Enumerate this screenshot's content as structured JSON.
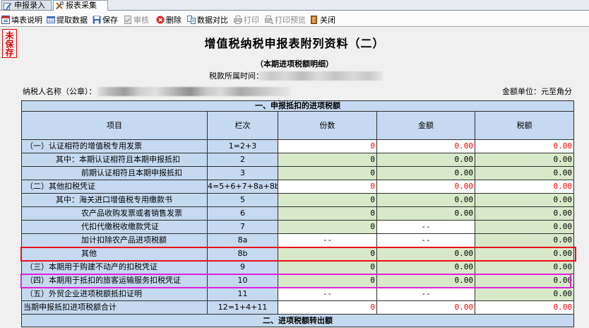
{
  "tabs": [
    {
      "label": "申报录入",
      "icon": "pencil-icon",
      "active": false
    },
    {
      "label": "报表采集",
      "icon": "tools-icon",
      "active": true
    }
  ],
  "toolbar": [
    {
      "label": "填表说明",
      "icon": "form-guide-icon",
      "enabled": true
    },
    {
      "label": "提取数据",
      "icon": "extract-data-icon",
      "enabled": true
    },
    {
      "label": "保存",
      "icon": "save-icon",
      "enabled": true
    },
    {
      "label": "审核",
      "icon": "audit-icon",
      "enabled": false
    },
    {
      "label": "删除",
      "icon": "delete-icon",
      "enabled": true
    },
    {
      "label": "数据对比",
      "icon": "compare-icon",
      "enabled": true
    },
    {
      "label": "打印",
      "icon": "print-icon",
      "enabled": false
    },
    {
      "label": "打印预览",
      "icon": "print-preview-icon",
      "enabled": false
    },
    {
      "label": "关闭",
      "icon": "close-icon",
      "enabled": true
    }
  ],
  "stamp": "未保存",
  "form": {
    "title": "增值税纳税申报表附列资料（二）",
    "subtitle": "（本期进项税额明细）",
    "period_label": "税款所属时间：",
    "taxpayer_label": "纳税人名称（公章）：",
    "unit_label": "金额单位：元至角分"
  },
  "table": {
    "section_1": "一、申报抵扣的进项税额",
    "columns": [
      "项目",
      "栏次",
      "份数",
      "金额",
      "税额"
    ],
    "rows": [
      {
        "item": "（一）认证相符的增值税专用发票",
        "line": "1=2+3",
        "count": "0",
        "amount": "0.00",
        "tax": "0.00"
      },
      {
        "item": "其中：本期认证相符且本期申报抵扣",
        "line": "2",
        "count": "0",
        "amount": "0.00",
        "tax": "0.00"
      },
      {
        "item": "前期认证相符且本期申报抵扣",
        "line": "3",
        "count": "0",
        "amount": "0.00",
        "tax": "0.00"
      },
      {
        "item": "（二）其他扣税凭证",
        "line": "4=5+6+7+8a+8b",
        "count": "0",
        "amount": "0.00",
        "tax": "0.00"
      },
      {
        "item": "其中：海关进口增值税专用缴款书",
        "line": "5",
        "count": "0",
        "amount": "0.00",
        "tax": "0.00"
      },
      {
        "item": "农产品收购发票或者销售发票",
        "line": "6",
        "count": "0",
        "amount": "0.00",
        "tax": "0.00"
      },
      {
        "item": "代扣代缴税收缴款凭证",
        "line": "7",
        "count": "0",
        "amount": "--",
        "tax": "0.00"
      },
      {
        "item": "加计扣除农产品进项税额",
        "line": "8a",
        "count": "--",
        "amount": "--",
        "tax": "0.00"
      },
      {
        "item": "其他",
        "line": "8b",
        "count": "0",
        "amount": "0.00",
        "tax": "0.00"
      },
      {
        "item": "（三）本期用于购建不动产的扣税凭证",
        "line": "9",
        "count": "0",
        "amount": "0.00",
        "tax": "0.00"
      },
      {
        "item": "（四）本期用于抵扣的旅客运输服务扣税凭证",
        "line": "10",
        "count": "0",
        "amount": "0.00",
        "tax": "0.00"
      },
      {
        "item": "（五）外贸企业进项税额抵扣证明",
        "line": "11",
        "count": "--",
        "amount": "--",
        "tax": "0.00"
      },
      {
        "item": "当期申报抵扣进项税额合计",
        "line": "12=1+4+11",
        "count": "0",
        "amount": "0.00",
        "tax": "0.00"
      }
    ],
    "section_2": "二、进项税额转出额"
  },
  "colors": {
    "label_cell": "#c5d9f1",
    "input_cell": "#d8e9c9",
    "computed_text": "#ff0000",
    "unsaved_stamp": "#e00000",
    "highlight_red": "#e8101a",
    "highlight_magenta": "#e020e0"
  }
}
